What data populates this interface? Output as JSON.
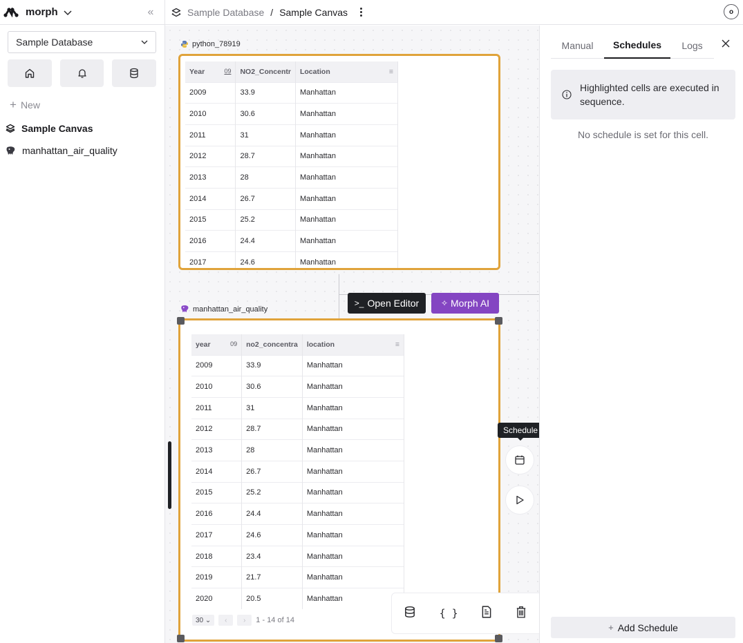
{
  "sidebar": {
    "brand": "morph",
    "database_select": "Sample Database",
    "new_label": "New",
    "items": [
      {
        "label": "Sample Canvas",
        "icon": "layers-icon"
      },
      {
        "label": "manhattan_air_quality",
        "icon": "postgres-icon"
      }
    ],
    "icon_buttons": [
      "home-icon",
      "bell-icon",
      "database-icon"
    ]
  },
  "header": {
    "breadcrumb_db": "Sample Database",
    "breadcrumb_sep": "/",
    "breadcrumb_canvas": "Sample Canvas",
    "avatar_initial": "o"
  },
  "canvas": {
    "cell1": {
      "name": "python_78919",
      "columns": [
        {
          "label": "Year",
          "badge": "09"
        },
        {
          "label": "NO2_Concentr"
        },
        {
          "label": "Location"
        }
      ],
      "rows": [
        [
          "2009",
          "33.9",
          "Manhattan"
        ],
        [
          "2010",
          "30.6",
          "Manhattan"
        ],
        [
          "2011",
          "31",
          "Manhattan"
        ],
        [
          "2012",
          "28.7",
          "Manhattan"
        ],
        [
          "2013",
          "28",
          "Manhattan"
        ],
        [
          "2014",
          "26.7",
          "Manhattan"
        ],
        [
          "2015",
          "25.2",
          "Manhattan"
        ],
        [
          "2016",
          "24.4",
          "Manhattan"
        ],
        [
          "2017",
          "24.6",
          "Manhattan"
        ]
      ]
    },
    "open_editor_label": "Open Editor",
    "morph_ai_label": "Morph AI",
    "cell2": {
      "name": "manhattan_air_quality",
      "columns": [
        {
          "label": "year",
          "badge": "09"
        },
        {
          "label": "no2_concentra"
        },
        {
          "label": "location"
        }
      ],
      "rows": [
        [
          "2009",
          "33.9",
          "Manhattan"
        ],
        [
          "2010",
          "30.6",
          "Manhattan"
        ],
        [
          "2011",
          "31",
          "Manhattan"
        ],
        [
          "2012",
          "28.7",
          "Manhattan"
        ],
        [
          "2013",
          "28",
          "Manhattan"
        ],
        [
          "2014",
          "26.7",
          "Manhattan"
        ],
        [
          "2015",
          "25.2",
          "Manhattan"
        ],
        [
          "2016",
          "24.4",
          "Manhattan"
        ],
        [
          "2017",
          "24.6",
          "Manhattan"
        ],
        [
          "2018",
          "23.4",
          "Manhattan"
        ],
        [
          "2019",
          "21.7",
          "Manhattan"
        ],
        [
          "2020",
          "20.5",
          "Manhattan"
        ]
      ],
      "page_size": "30",
      "page_info": "1 - 14 of 14"
    },
    "tooltip": "Schedule",
    "tools": [
      "database-icon",
      "braces-icon",
      "document-icon",
      "trash-icon"
    ]
  },
  "right_panel": {
    "tabs": [
      {
        "label": "Manual",
        "active": false
      },
      {
        "label": "Schedules",
        "active": true
      },
      {
        "label": "Logs",
        "active": false
      }
    ],
    "info_text": "Highlighted cells are executed in sequence.",
    "empty_text": "No schedule is set for this cell.",
    "add_schedule_label": "Add Schedule"
  },
  "colors": {
    "cell_border": "#e0a33a",
    "morph_ai": "#8445c2",
    "editor_button": "#1f2125"
  }
}
